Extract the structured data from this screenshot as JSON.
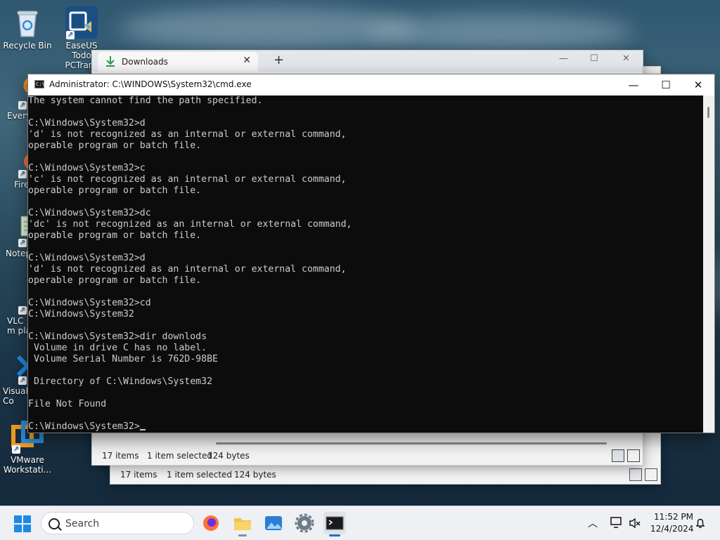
{
  "desktop": {
    "icons": [
      {
        "label": "Recycle Bin"
      },
      {
        "label": "EaseUS Todo PCTrans"
      },
      {
        "label": "Every"
      },
      {
        "label": "Fire"
      },
      {
        "label": "Notep"
      },
      {
        "label": "VLC m pla"
      },
      {
        "label": "Visual Co"
      },
      {
        "label": "VMware Workstati..."
      }
    ]
  },
  "explorer_front": {
    "tab_label": "Downloads",
    "status_items": "17 items",
    "status_selected": "1 item selected",
    "status_size": "124 bytes"
  },
  "explorer_back": {
    "status_items": "17 items",
    "status_selected": "1 item selected",
    "status_size": "124 bytes"
  },
  "cmd": {
    "title": "Administrator: C:\\WINDOWS\\System32\\cmd.exe",
    "lines": [
      "The system cannot find the path specified.",
      "",
      "C:\\Windows\\System32>d",
      "'d' is not recognized as an internal or external command,",
      "operable program or batch file.",
      "",
      "C:\\Windows\\System32>c",
      "'c' is not recognized as an internal or external command,",
      "operable program or batch file.",
      "",
      "C:\\Windows\\System32>dc",
      "'dc' is not recognized as an internal or external command,",
      "operable program or batch file.",
      "",
      "C:\\Windows\\System32>d",
      "'d' is not recognized as an internal or external command,",
      "operable program or batch file.",
      "",
      "C:\\Windows\\System32>cd",
      "C:\\Windows\\System32",
      "",
      "C:\\Windows\\System32>dir downlods",
      " Volume in drive C has no label.",
      " Volume Serial Number is 762D-98BE",
      "",
      " Directory of C:\\Windows\\System32",
      "",
      "File Not Found",
      ""
    ],
    "prompt": "C:\\Windows\\System32>"
  },
  "taskbar": {
    "search_placeholder": "Search",
    "time": "11:52 PM",
    "date": "12/4/2024"
  },
  "colors": {
    "console_bg": "#0c0c0c",
    "console_fg": "#cccccc",
    "accent": "#1f6fd0"
  }
}
